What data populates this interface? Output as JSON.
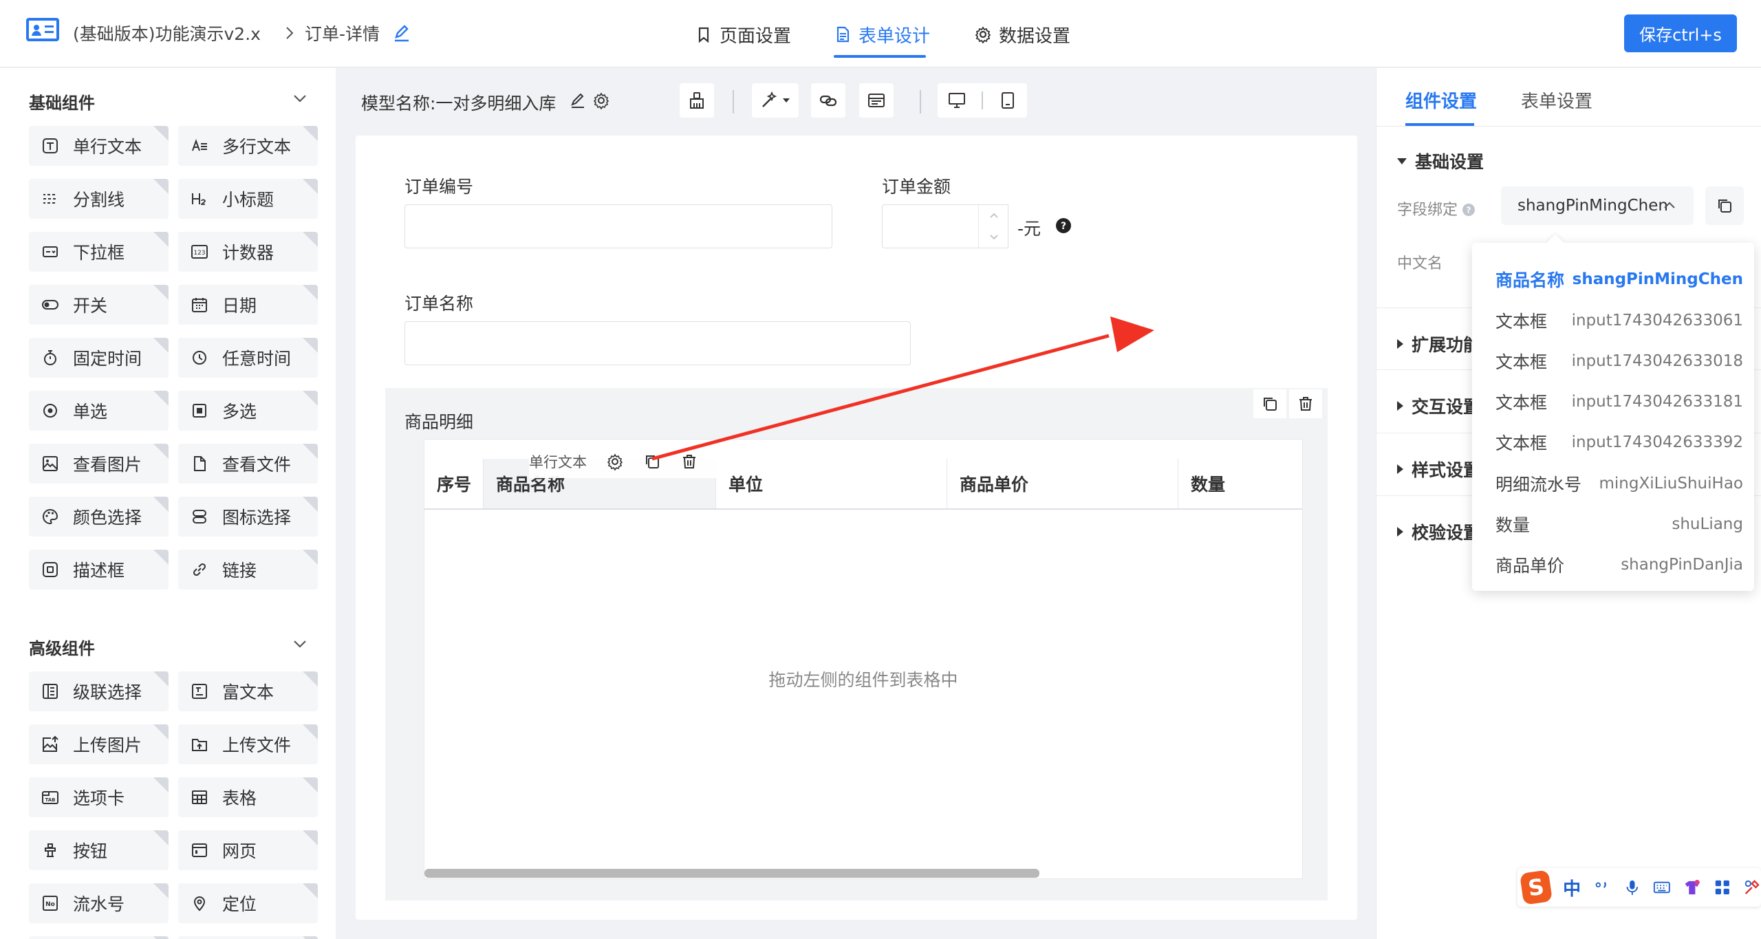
{
  "header": {
    "app_name": "(基础版本)功能演示v2.x",
    "page_name": "订单-详情",
    "tabs": [
      {
        "label": "页面设置",
        "icon": "bookmark-icon"
      },
      {
        "label": "表单设计",
        "icon": "document-icon"
      },
      {
        "label": "数据设置",
        "icon": "gear-icon"
      }
    ],
    "active_tab": "表单设计",
    "save_label": "保存ctrl+s"
  },
  "left_panel": {
    "basic_title": "基础组件",
    "basic_items": [
      {
        "label": "单行文本",
        "icon": "text-t-icon"
      },
      {
        "label": "多行文本",
        "icon": "multiline-text-icon"
      },
      {
        "label": "分割线",
        "icon": "divider-icon"
      },
      {
        "label": "小标题",
        "icon": "heading-h2-icon"
      },
      {
        "label": "下拉框",
        "icon": "dropdown-icon"
      },
      {
        "label": "计数器",
        "icon": "counter-123-icon"
      },
      {
        "label": "开关",
        "icon": "toggle-icon"
      },
      {
        "label": "日期",
        "icon": "calendar-icon"
      },
      {
        "label": "固定时间",
        "icon": "stopwatch-icon"
      },
      {
        "label": "任意时间",
        "icon": "clock-icon"
      },
      {
        "label": "单选",
        "icon": "radio-icon"
      },
      {
        "label": "多选",
        "icon": "checkbox-icon"
      },
      {
        "label": "查看图片",
        "icon": "image-icon"
      },
      {
        "label": "查看文件",
        "icon": "file-icon"
      },
      {
        "label": "颜色选择",
        "icon": "palette-icon"
      },
      {
        "label": "图标选择",
        "icon": "icon-select-icon"
      },
      {
        "label": "描述框",
        "icon": "description-icon"
      },
      {
        "label": "链接",
        "icon": "link-icon"
      }
    ],
    "advanced_title": "高级组件",
    "advanced_items": [
      {
        "label": "级联选择",
        "icon": "cascade-icon"
      },
      {
        "label": "富文本",
        "icon": "rich-text-icon"
      },
      {
        "label": "上传图片",
        "icon": "upload-image-icon"
      },
      {
        "label": "上传文件",
        "icon": "upload-file-icon"
      },
      {
        "label": "选项卡",
        "icon": "tab-icon"
      },
      {
        "label": "表格",
        "icon": "table-icon"
      },
      {
        "label": "按钮",
        "icon": "button-icon"
      },
      {
        "label": "网页",
        "icon": "webpage-icon"
      },
      {
        "label": "流水号",
        "icon": "serial-no-icon"
      },
      {
        "label": "定位",
        "icon": "location-pin-icon"
      }
    ]
  },
  "canvas": {
    "model_label": "模型名称:一对多明细入库",
    "fields": {
      "order_no_label": "订单编号",
      "order_amount_label": "订单金额",
      "amount_suffix": "-元",
      "order_name_label": "订单名称"
    },
    "subtable": {
      "title": "商品明细",
      "columns": [
        "序号",
        "商品名称",
        "单位",
        "商品单价",
        "数量"
      ],
      "float_toolbar_label": "单行文本",
      "empty_hint": "拖动左侧的组件到表格中"
    }
  },
  "right_panel": {
    "tabs": [
      "组件设置",
      "表单设置"
    ],
    "sections": {
      "basic": "基础设置",
      "extend": "扩展功能",
      "interact": "交互设置",
      "style": "样式设置",
      "validate": "校验设置"
    },
    "field_binding_label": "字段绑定",
    "field_binding_value": "shangPinMingChen",
    "chinese_name_label": "中文名"
  },
  "dropdown": {
    "options": [
      {
        "cn": "商品名称",
        "en": "shangPinMingChen",
        "selected": true
      },
      {
        "cn": "文本框",
        "en": "input1743042633061",
        "selected": false
      },
      {
        "cn": "文本框",
        "en": "input1743042633018",
        "selected": false
      },
      {
        "cn": "文本框",
        "en": "input1743042633181",
        "selected": false
      },
      {
        "cn": "文本框",
        "en": "input1743042633392",
        "selected": false
      },
      {
        "cn": "明细流水号",
        "en": "mingXiLiuShuiHao",
        "selected": false
      },
      {
        "cn": "数量",
        "en": "shuLiang",
        "selected": false
      },
      {
        "cn": "商品单价",
        "en": "shangPinDanJia",
        "selected": false
      }
    ]
  },
  "ime": {
    "brand": "S",
    "mode": "中"
  },
  "colors": {
    "accent": "#2878f0",
    "annotation": "#f03225"
  }
}
